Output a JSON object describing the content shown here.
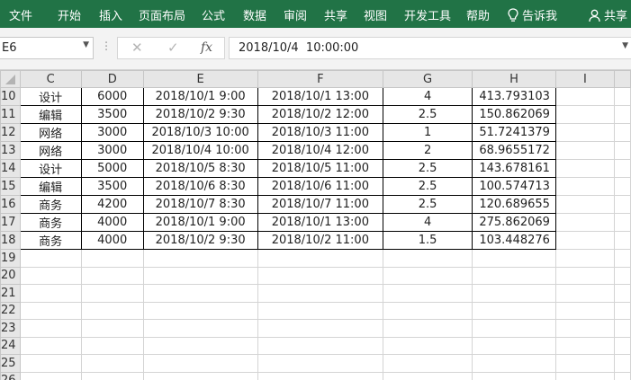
{
  "ribbon": {
    "tabs": [
      "文件",
      "开始",
      "插入",
      "页面布局",
      "公式",
      "数据",
      "审阅",
      "共享",
      "视图",
      "开发工具",
      "帮助"
    ],
    "tell_me": "告诉我",
    "share": "共享"
  },
  "formula_bar": {
    "name_box": "E6",
    "cancel_symbol": "✕",
    "enter_symbol": "✓",
    "fx_label": "fx",
    "content": "2018/10/4  10:00:00"
  },
  "sheet": {
    "columns": [
      "C",
      "D",
      "E",
      "F",
      "G",
      "H",
      "I"
    ],
    "rows": [
      {
        "row": "10",
        "cells": [
          "设计",
          "6000",
          "2018/10/1 9:00",
          "2018/10/1 13:00",
          "4",
          "413.793103"
        ]
      },
      {
        "row": "11",
        "cells": [
          "编辑",
          "3500",
          "2018/10/2 9:30",
          "2018/10/2 12:00",
          "2.5",
          "150.862069"
        ]
      },
      {
        "row": "12",
        "cells": [
          "网络",
          "3000",
          "2018/10/3 10:00",
          "2018/10/3 11:00",
          "1",
          "51.7241379"
        ]
      },
      {
        "row": "13",
        "cells": [
          "网络",
          "3000",
          "2018/10/4 10:00",
          "2018/10/4 12:00",
          "2",
          "68.9655172"
        ]
      },
      {
        "row": "14",
        "cells": [
          "设计",
          "5000",
          "2018/10/5 8:30",
          "2018/10/5 11:00",
          "2.5",
          "143.678161"
        ]
      },
      {
        "row": "15",
        "cells": [
          "编辑",
          "3500",
          "2018/10/6 8:30",
          "2018/10/6 11:00",
          "2.5",
          "100.574713"
        ]
      },
      {
        "row": "16",
        "cells": [
          "商务",
          "4200",
          "2018/10/7 8:30",
          "2018/10/7 11:00",
          "2.5",
          "120.689655"
        ]
      },
      {
        "row": "17",
        "cells": [
          "商务",
          "4000",
          "2018/10/1 9:00",
          "2018/10/1 13:00",
          "4",
          "275.862069"
        ]
      },
      {
        "row": "18",
        "cells": [
          "商务",
          "4000",
          "2018/10/2 9:30",
          "2018/10/2 11:00",
          "1.5",
          "103.448276"
        ]
      }
    ],
    "empty_rows": [
      "19",
      "20",
      "21",
      "22",
      "23",
      "24",
      "25",
      "26"
    ]
  }
}
